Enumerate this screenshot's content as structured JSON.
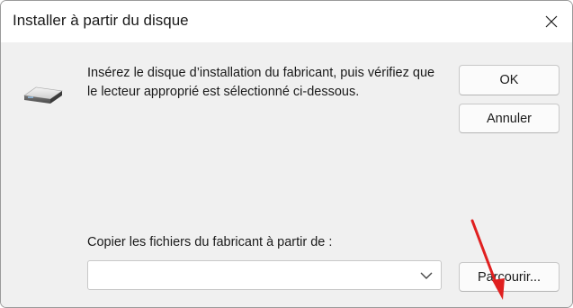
{
  "window": {
    "title": "Installer à partir du disque",
    "close_icon": "close-icon"
  },
  "content": {
    "icon": "disk-drive-icon",
    "instructions": "Insérez le disque d’installation du fabricant, puis vérifiez que le lecteur approprié est sélectionné ci-dessous.",
    "copy_label": "Copier les fichiers du fabricant à partir de :",
    "path_value": "",
    "path_dropdown_icon": "chevron-down-icon"
  },
  "buttons": {
    "ok": "OK",
    "cancel": "Annuler",
    "browse": "Parcourir..."
  },
  "annotation": {
    "icon": "red-arrow-icon",
    "color": "#e02020"
  }
}
